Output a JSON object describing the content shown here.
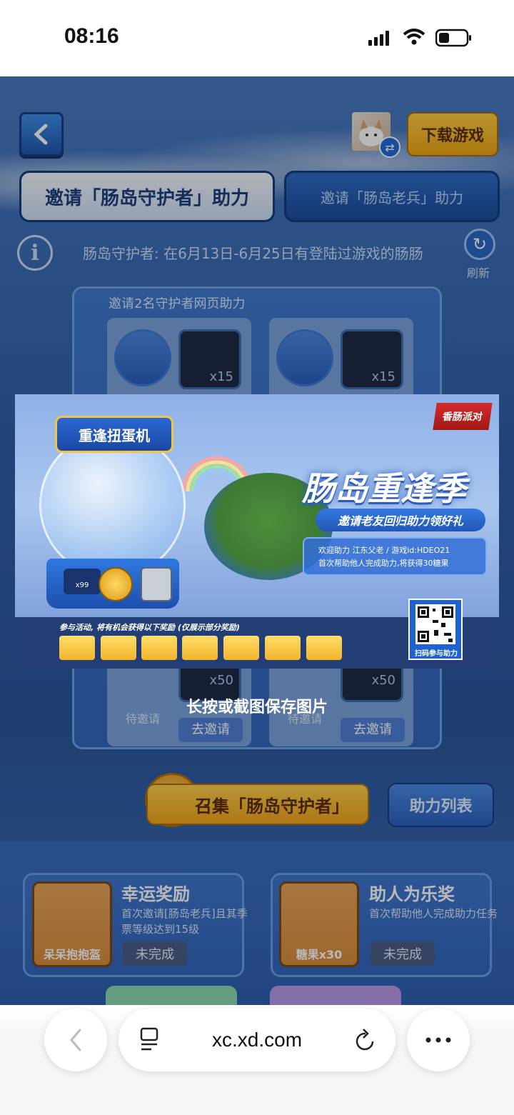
{
  "status_bar": {
    "time": "08:16"
  },
  "header": {
    "download_label": "下载游戏"
  },
  "tabs": [
    {
      "label": "邀请「肠岛守护者」助力"
    },
    {
      "label": "邀请「肠岛老兵」助力"
    }
  ],
  "info": {
    "text": "肠岛守护者: 在6月13日-6月25日有登陆过游戏的肠肠",
    "refresh_label": "刷新"
  },
  "panel": {
    "title": "邀请2名守护者网页助力",
    "cards": [
      {
        "reward_top": "x15",
        "reward_bottom": "x50",
        "status": "待邀请",
        "button": "去邀请"
      },
      {
        "reward_top": "x15",
        "reward_bottom": "x50",
        "status": "待邀请",
        "button": "去邀请"
      }
    ]
  },
  "poster": {
    "logo": "香肠派对",
    "machine_title": "重逢扭蛋机",
    "machine_counter": "x99",
    "headline": "肠岛重逢季",
    "subline": "邀请老友回归助力领好礼",
    "welcome_line1": "欢迎助力 江东父老 / 游戏id:HDEO21",
    "welcome_line2": "首次帮助他人完成助力,将获得30糖果",
    "strip_label": "参与活动, 将有机会获得以下奖励 (仅展示部分奖励)",
    "qr_label": "扫码参与助力"
  },
  "save_tip": "长按或截图保存图片",
  "actions": {
    "gather": "召集「肠岛守护者」",
    "help_list": "助力列表"
  },
  "bonus_cards": [
    {
      "title": "幸运奖励",
      "desc": "首次邀请[肠岛老兵]且其季票等级达到15级",
      "thumb_label": "呆呆抱抱盔",
      "status": "未完成"
    },
    {
      "title": "助人为乐奖",
      "desc": "首次帮助他人完成助力任务",
      "thumb_label": "糖果x30",
      "status": "未完成"
    }
  ],
  "browser": {
    "url": "xc.xd.com"
  }
}
